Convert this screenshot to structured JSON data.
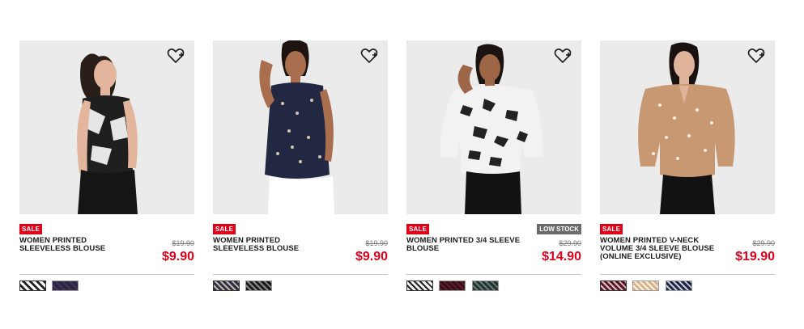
{
  "products": [
    {
      "badge": "SALE",
      "stock_badge": "",
      "name": "WOMEN PRINTED SLEEVELESS BLOUSE",
      "old_price": "$19.90",
      "price": "$9.90",
      "swatches": [
        "black-white-print",
        "navy-print"
      ]
    },
    {
      "badge": "SALE",
      "stock_badge": "",
      "name": "WOMEN PRINTED SLEEVELESS BLOUSE",
      "old_price": "$19.90",
      "price": "$9.90",
      "swatches": [
        "navy-floral-print",
        "black-print"
      ]
    },
    {
      "badge": "SALE",
      "stock_badge": "LOW STOCK",
      "name": "WOMEN PRINTED 3/4 SLEEVE BLOUSE",
      "old_price": "$29.90",
      "price": "$14.90",
      "swatches": [
        "white-black-print",
        "wine-print",
        "dark-green-print"
      ]
    },
    {
      "badge": "SALE",
      "stock_badge": "",
      "name": "WOMEN PRINTED V-NECK VOLUME 3/4 SLEEVE BLOUSE (ONLINE EXCLUSIVE)",
      "old_price": "$29.90",
      "price": "$19.90",
      "swatches": [
        "wine-print",
        "beige-print",
        "navy-print"
      ]
    }
  ],
  "colors": {
    "sale_red": "#e0001a",
    "low_stock_gray": "#6b6b6b",
    "photo_bg": "#ebebeb"
  },
  "icons": {
    "favorite": "heart-plus-icon"
  }
}
